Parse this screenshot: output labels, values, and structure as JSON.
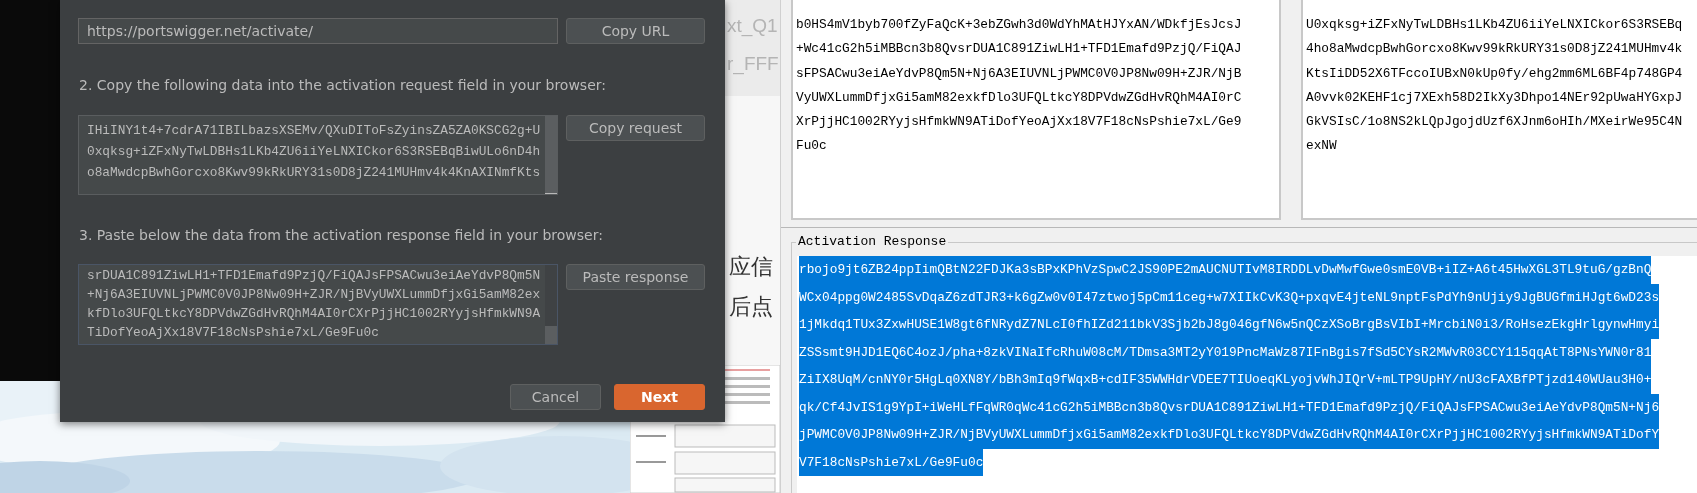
{
  "background_window": {
    "titles": [
      "xt_Q1",
      "r_FFF"
    ],
    "chinese_lines": [
      "应信",
      "后点"
    ]
  },
  "dialog": {
    "url_field": {
      "value": "https://portswigger.net/activate/"
    },
    "copy_url_button": "Copy URL",
    "step2": "2. Copy the following data into the activation request field in your browser:",
    "request_lines": [
      "IHiINY1t4+7cdrA71IBILbazsXSEMv/QXuDIToFsZyinsZA5ZA0KSCG2g+U",
      "0xqksg+iZFxNyTwLDBHs1LKb4ZU6iiYeLNXICkor6S3RSEBqBiwULo6nD4h",
      "o8aMwdcpBwhGorcxo8Kwv99kRkURY31s0D8jZ241MUHmv4k4KnAXINmfKts"
    ],
    "copy_request_button": "Copy request",
    "step3": "3. Paste below the data from the activation response field in your browser:",
    "response_lines": [
      "srDUA1C891ZiwLH1+TFD1Emafd9PzjQ/FiQAJsFPSACwu3eiAeYdvP8Qm5N",
      "+Nj6A3EIUVNLjPWMC0V0JP8Nw09H+ZJR/NjBVyUWXLummDfjxGi5amM82ex",
      "kfDlo3UFQLtkcY8DPVdwZGdHvRQhM4AI0rCXrPjjHC1002RYyjsHfmkWN9A",
      "TiDofYeoAjXx18V7F18cNsPshie7xL/Ge9Fu0c"
    ],
    "paste_response_button": "Paste response",
    "buttons": [
      {
        "label": "Cancel",
        "kind": "secondary"
      },
      {
        "label": "Next",
        "kind": "primary"
      }
    ]
  },
  "license_window": {
    "request_left_lines": [
      "b0HS4mV1byb700fZyFaQcK+3ebZGwh3d0WdYhMAtHJYxAN/WDkfjEsJcsJ",
      "+Wc41cG2h5iMBBcn3b8QvsrDUA1C891ZiwLH1+TFD1Emafd9PzjQ/FiQAJ",
      "sFPSACwu3eiAeYdvP8Qm5N+Nj6A3EIUVNLjPWMC0V0JP8Nw09H+ZJR/NjB",
      "VyUWXLummDfjxGi5amM82exkfDlo3UFQLtkcY8DPVdwZGdHvRQhM4AI0rC",
      "XrPjjHC1002RYyjsHfmkWN9ATiDofYeoAjXx18V7F18cNsPshie7xL/Ge9",
      "Fu0c"
    ],
    "request_right_lines": [
      "U0xqksg+iZFxNyTwLDBHs1LKb4ZU6iiYeLNXICkor6S3RSEBq",
      "4ho8aMwdcpBwhGorcxo8Kwv99kRkURY31s0D8jZ241MUHmv4k",
      "KtsIiDD52X6TFccoIUBxN0kUp0fy/ehg2mm6ML6BF4p748GP4",
      "A0vvk02KEHF1cj7XExh58D2IkXy3Dhpo14NEr92pUwaHYGxpJ",
      "GkVSIsC/1o8NS2kLQpJgojdUzf6XJnm6oHIh/MXeirWe95C4N",
      "exNW"
    ],
    "activation_response": {
      "label": "Activation Response",
      "text_selected": true,
      "lines": [
        "rbojo9jt6ZB24ppIimQBtN22FDJKa3sBPxKPhVzSpwC2JS90PE2mAUCNUTIvM8IRDDLvDwMwfGwe0smE0VB+iIZ+A6t45HwXGL3TL9tuG/gzBnQ",
        "WCx04ppg0W2485SvDqaZ6zdTJR3+k6gZw0v0I47ztwoj5pCm11ceg+w7XIIkCvK3Q+pxqvE4jteNL9nptFsPdYh9nUjiy9JgBUGfmiHJgt6wD23s",
        "1jMkdq1TUx3ZxwHUSE1W8gt6fNRydZ7NLcI0fhIZd211bkV3Sjb2bJ8g046gfN6w5nQCzXSoBrgBsVIbI+MrcbiN0i3/RoHsezEkgHrlgynwHmyi",
        "ZSSsmt9HJD1EQ6C4ozJ/pha+8zkVINaIfcRhuW08cM/TDmsa3MT2yY019PncMaWz87IFnBgis7fSd5CYsR2MWvR03CCY115qqAtT8PNsYWN0r81",
        "ZiIX8UqM/cnNY0r5HgLq0XN8Y/bBh3mIq9fWqxB+cdIF35WWHdrVDEE7TIUoeqKLyojvWhJIQrV+mLTP9UpHY/nU3cFAXBfPTjzd140WUau3H0+",
        "qk/Cf4JvIS1g9YpI+iWeHLfFqWR0qWc41cG2h5iMBBcn3b8QvsrDUA1C891ZiwLH1+TFD1Emafd9PzjQ/FiQAJsFPSACwu3eiAeYdvP8Qm5N+Nj6",
        "jPWMC0V0JP8Nw09H+ZJR/NjBVyUWXLummDfjxGi5amM82exkfDlo3UFQLtkcY8DPVdwZGdHvRQhM4AI0rCXrPjjHC1002RYyjsHfmkWN9ATiDofY",
        "V7F18cNsPshie7xL/Ge9Fu0c"
      ]
    }
  }
}
